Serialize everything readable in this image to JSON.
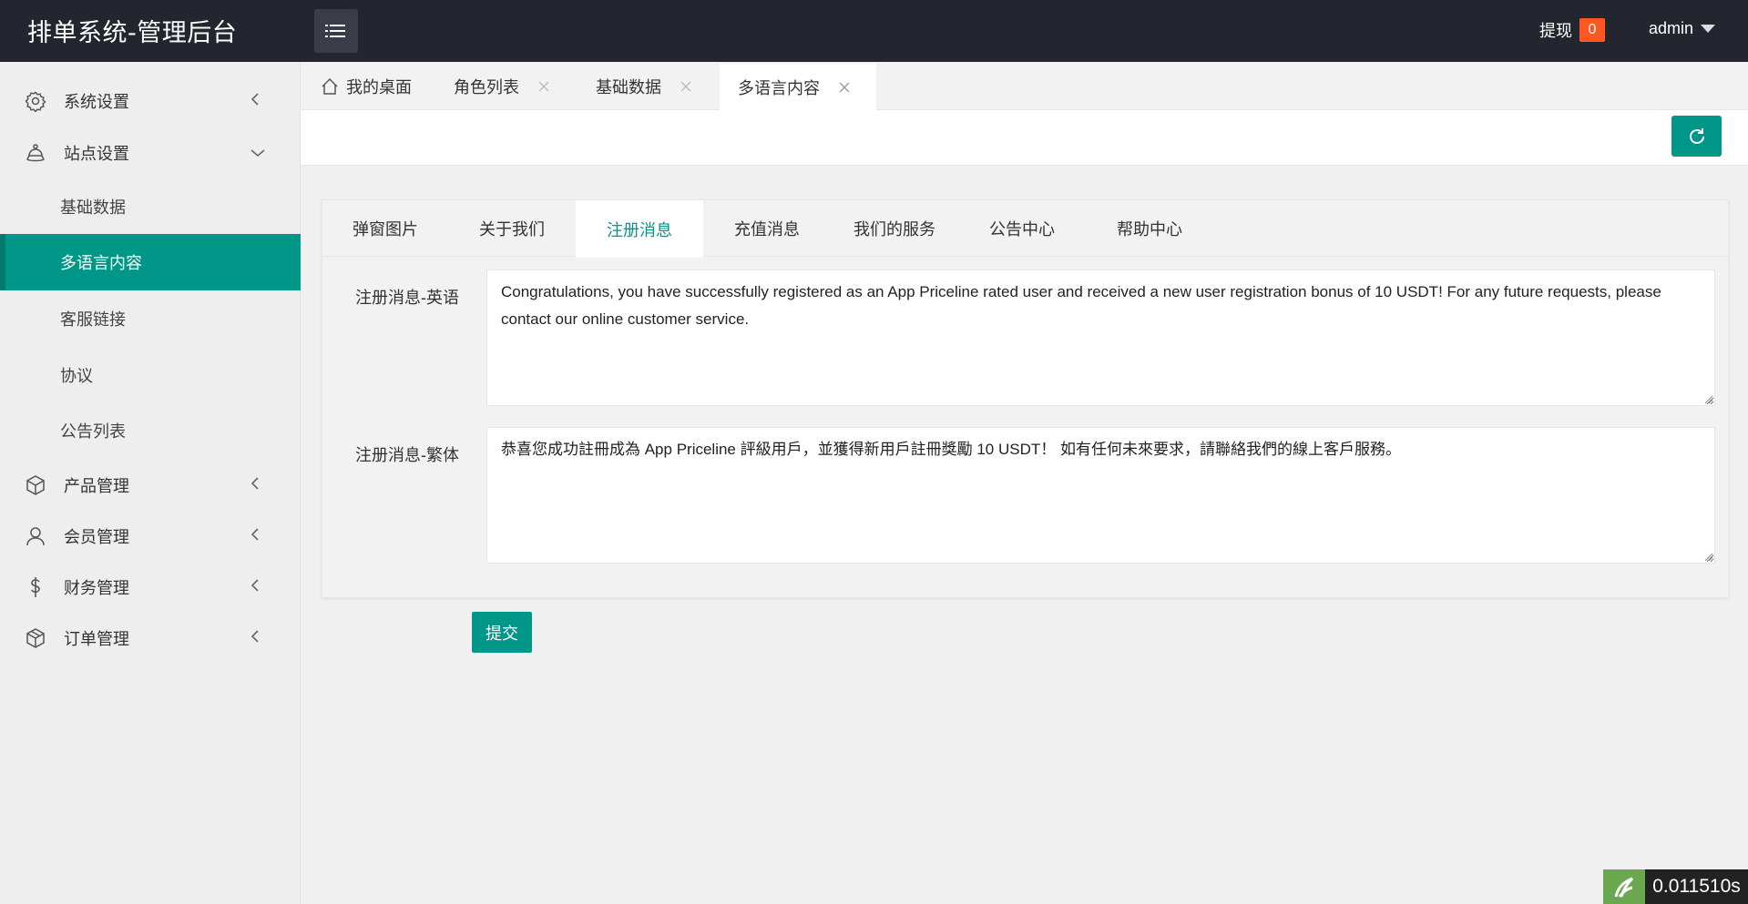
{
  "header": {
    "title": "排单系统-管理后台",
    "withdraw_label": "提现",
    "withdraw_count": "0",
    "user_name": "admin"
  },
  "sidebar": {
    "items": [
      {
        "label": "系统设置",
        "icon": "gear-icon",
        "expanded": false
      },
      {
        "label": "站点设置",
        "icon": "site-icon",
        "expanded": true,
        "children": [
          "基础数据",
          "多语言内容",
          "客服链接",
          "协议",
          "公告列表"
        ],
        "active_child": "多语言内容"
      },
      {
        "label": "产品管理",
        "icon": "box-icon",
        "expanded": false
      },
      {
        "label": "会员管理",
        "icon": "user-icon",
        "expanded": false
      },
      {
        "label": "财务管理",
        "icon": "dollar-icon",
        "expanded": false
      },
      {
        "label": "订单管理",
        "icon": "order-box-icon",
        "expanded": false
      }
    ]
  },
  "page_tabs": [
    {
      "label": "我的桌面",
      "icon": "home-icon",
      "closable": false
    },
    {
      "label": "角色列表",
      "closable": true
    },
    {
      "label": "基础数据",
      "closable": true
    },
    {
      "label": "多语言内容",
      "closable": true,
      "active": true
    }
  ],
  "content": {
    "tabs": [
      "弹窗图片",
      "关于我们",
      "注册消息",
      "充值消息",
      "我们的服务",
      "公告中心",
      "帮助中心"
    ],
    "active_tab": "注册消息",
    "fields": [
      {
        "label": "注册消息-英语",
        "value": "Congratulations, you have successfully registered as an App Priceline rated user and received a new user registration bonus of 10 USDT! For any future requests, please contact our online customer service."
      },
      {
        "label": "注册消息-繁体",
        "value": "恭喜您成功註冊成為 App Priceline 評級用戶，並獲得新用戶註冊獎勵 10 USDT！ 如有任何未來要求，請聯絡我們的線上客戶服務。"
      }
    ],
    "submit_label": "提交"
  },
  "perf_badge": "0.011510s",
  "colors": {
    "accent": "#009688",
    "header_bg": "#23262e",
    "badge": "#ff5722"
  }
}
